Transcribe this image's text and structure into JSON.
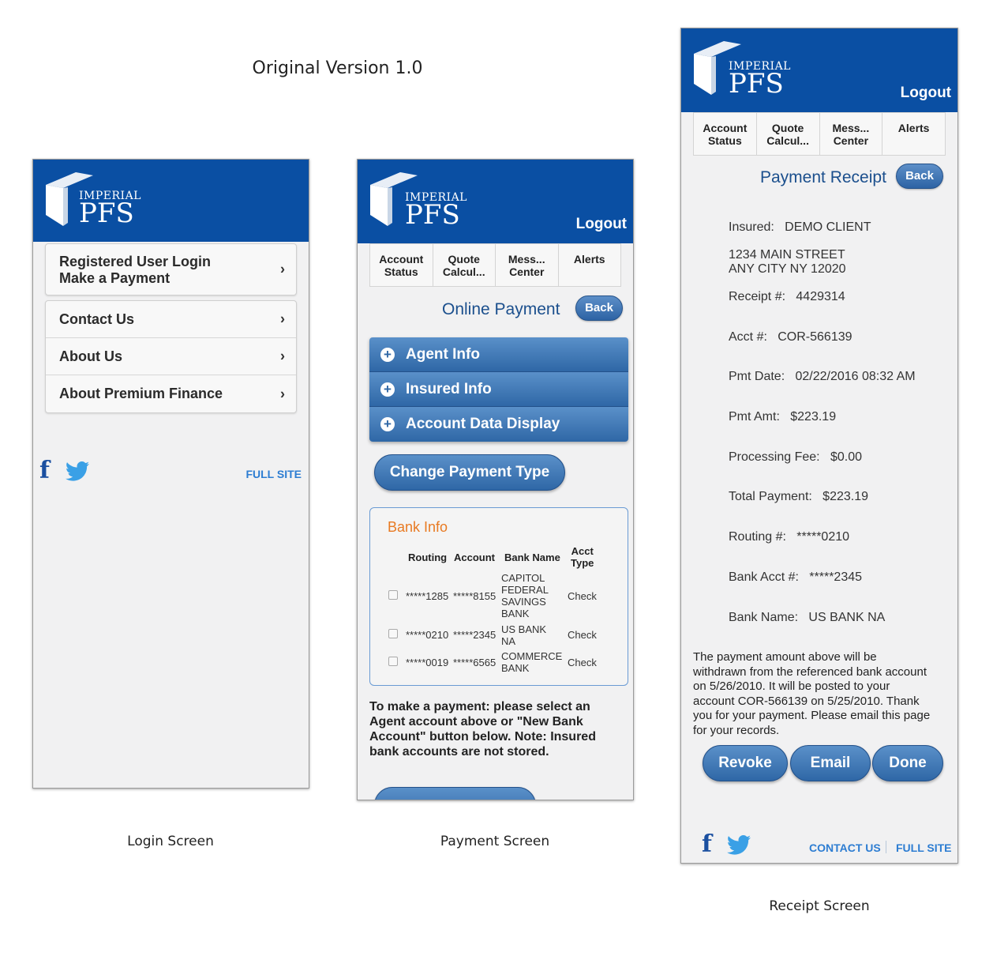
{
  "page_title": "Original Version 1.0",
  "captions": {
    "login": "Login Screen",
    "payment": "Payment Screen",
    "receipt": "Receipt Screen"
  },
  "brand": {
    "imperial": "IMPERIAL",
    "pfs": "PFS",
    "color": "#0a4fa3"
  },
  "header": {
    "logout": "Logout"
  },
  "tabs": [
    {
      "line1": "Account",
      "line2": "Status"
    },
    {
      "line1": "Quote",
      "line2": "Calcul..."
    },
    {
      "line1": "Mess...",
      "line2": "Center"
    },
    {
      "line1": "Alerts",
      "line2": ""
    }
  ],
  "login": {
    "menu_primary": {
      "line1": "Registered User Login",
      "line2": "Make a Payment"
    },
    "menu_items": [
      "Contact Us",
      "About Us",
      "About Premium Finance"
    ],
    "full_site": "FULL SITE"
  },
  "payment": {
    "title": "Online Payment",
    "back": "Back",
    "accordion": [
      "Agent Info",
      "Insured Info",
      "Account Data Display"
    ],
    "change_payment_type": "Change Payment Type",
    "bank_info": {
      "title": "Bank Info",
      "headers": {
        "routing": "Routing",
        "account": "Account",
        "bank_name": "Bank Name",
        "acct_type_1": "Acct",
        "acct_type_2": "Type"
      },
      "rows": [
        {
          "routing": "*****1285",
          "account": "*****8155",
          "bank_name": [
            "CAPITOL",
            "FEDERAL",
            "SAVINGS",
            "BANK"
          ],
          "type": "Check"
        },
        {
          "routing": "*****0210",
          "account": "*****2345",
          "bank_name": [
            "US BANK",
            "NA"
          ],
          "type": "Check"
        },
        {
          "routing": "*****0019",
          "account": "*****6565",
          "bank_name": [
            "COMMERCE",
            "BANK"
          ],
          "type": "Check"
        }
      ]
    },
    "note": [
      "To make a payment: please select an",
      "Agent account above or \"New Bank",
      "Account\" button below. Note: Insured",
      "bank accounts are not stored."
    ]
  },
  "receipt": {
    "title": "Payment Receipt",
    "back": "Back",
    "insured_label": "Insured:",
    "insured_value": "DEMO CLIENT",
    "address_1": "1234 MAIN STREET",
    "address_2": "ANY CITY NY 12020",
    "fields": [
      {
        "label": "Receipt #:",
        "value": "4429314"
      },
      {
        "label": "Acct #:",
        "value": "COR-566139"
      },
      {
        "label": "Pmt Date:",
        "value": "02/22/2016 08:32 AM"
      },
      {
        "label": "Pmt Amt:",
        "value": "$223.19"
      },
      {
        "label": "Processing Fee:",
        "value": "$0.00"
      },
      {
        "label": "Total Payment:",
        "value": "$223.19"
      },
      {
        "label": "Routing #:",
        "value": "*****0210"
      },
      {
        "label": "Bank Acct #:",
        "value": "*****2345"
      },
      {
        "label": "Bank Name:",
        "value": "US BANK NA"
      }
    ],
    "note": [
      "The payment amount above will be",
      "withdrawn from the referenced bank account",
      "on 5/26/2010. It will be posted to your",
      "account COR-566139 on 5/25/2010. Thank",
      "you for your payment. Please email this page",
      "for your records."
    ],
    "buttons": {
      "revoke": "Revoke",
      "email": "Email",
      "done": "Done"
    },
    "contact_us": "CONTACT US",
    "full_site": "FULL SITE"
  }
}
